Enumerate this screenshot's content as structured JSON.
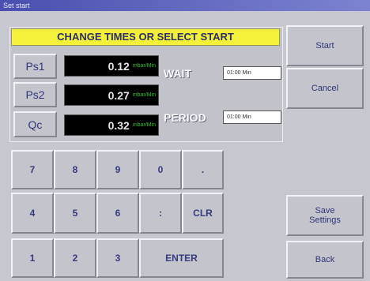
{
  "window": {
    "title": "Set start"
  },
  "banner": {
    "text": "CHANGE TIMES OR SELECT START"
  },
  "channels": [
    {
      "label": "Ps1",
      "value": "0.12",
      "unit": "mbar/Min"
    },
    {
      "label": "Ps2",
      "value": "0.27",
      "unit": "mbar/Min"
    },
    {
      "label": "Qc",
      "value": "0.32",
      "unit": "mbar/Min"
    }
  ],
  "wait": {
    "label": "WAIT",
    "value": "01:00 Min"
  },
  "period": {
    "label": "PERIOD",
    "value": "01:00 Min"
  },
  "keypad": {
    "k7": "7",
    "k8": "8",
    "k9": "9",
    "k0": "0",
    "kdot": ".",
    "k4": "4",
    "k5": "5",
    "k6": "6",
    "kcolon": ":",
    "clr": "CLR",
    "k1": "1",
    "k2": "2",
    "k3": "3",
    "enter": "ENTER"
  },
  "actions": {
    "start": "Start",
    "cancel": "Cancel",
    "save_line1": "Save",
    "save_line2": "Settings",
    "back": "Back"
  },
  "colors": {
    "banner": "#f3f03a",
    "background": "#c7c8cf",
    "readout_unit": "#3bbd3b"
  }
}
